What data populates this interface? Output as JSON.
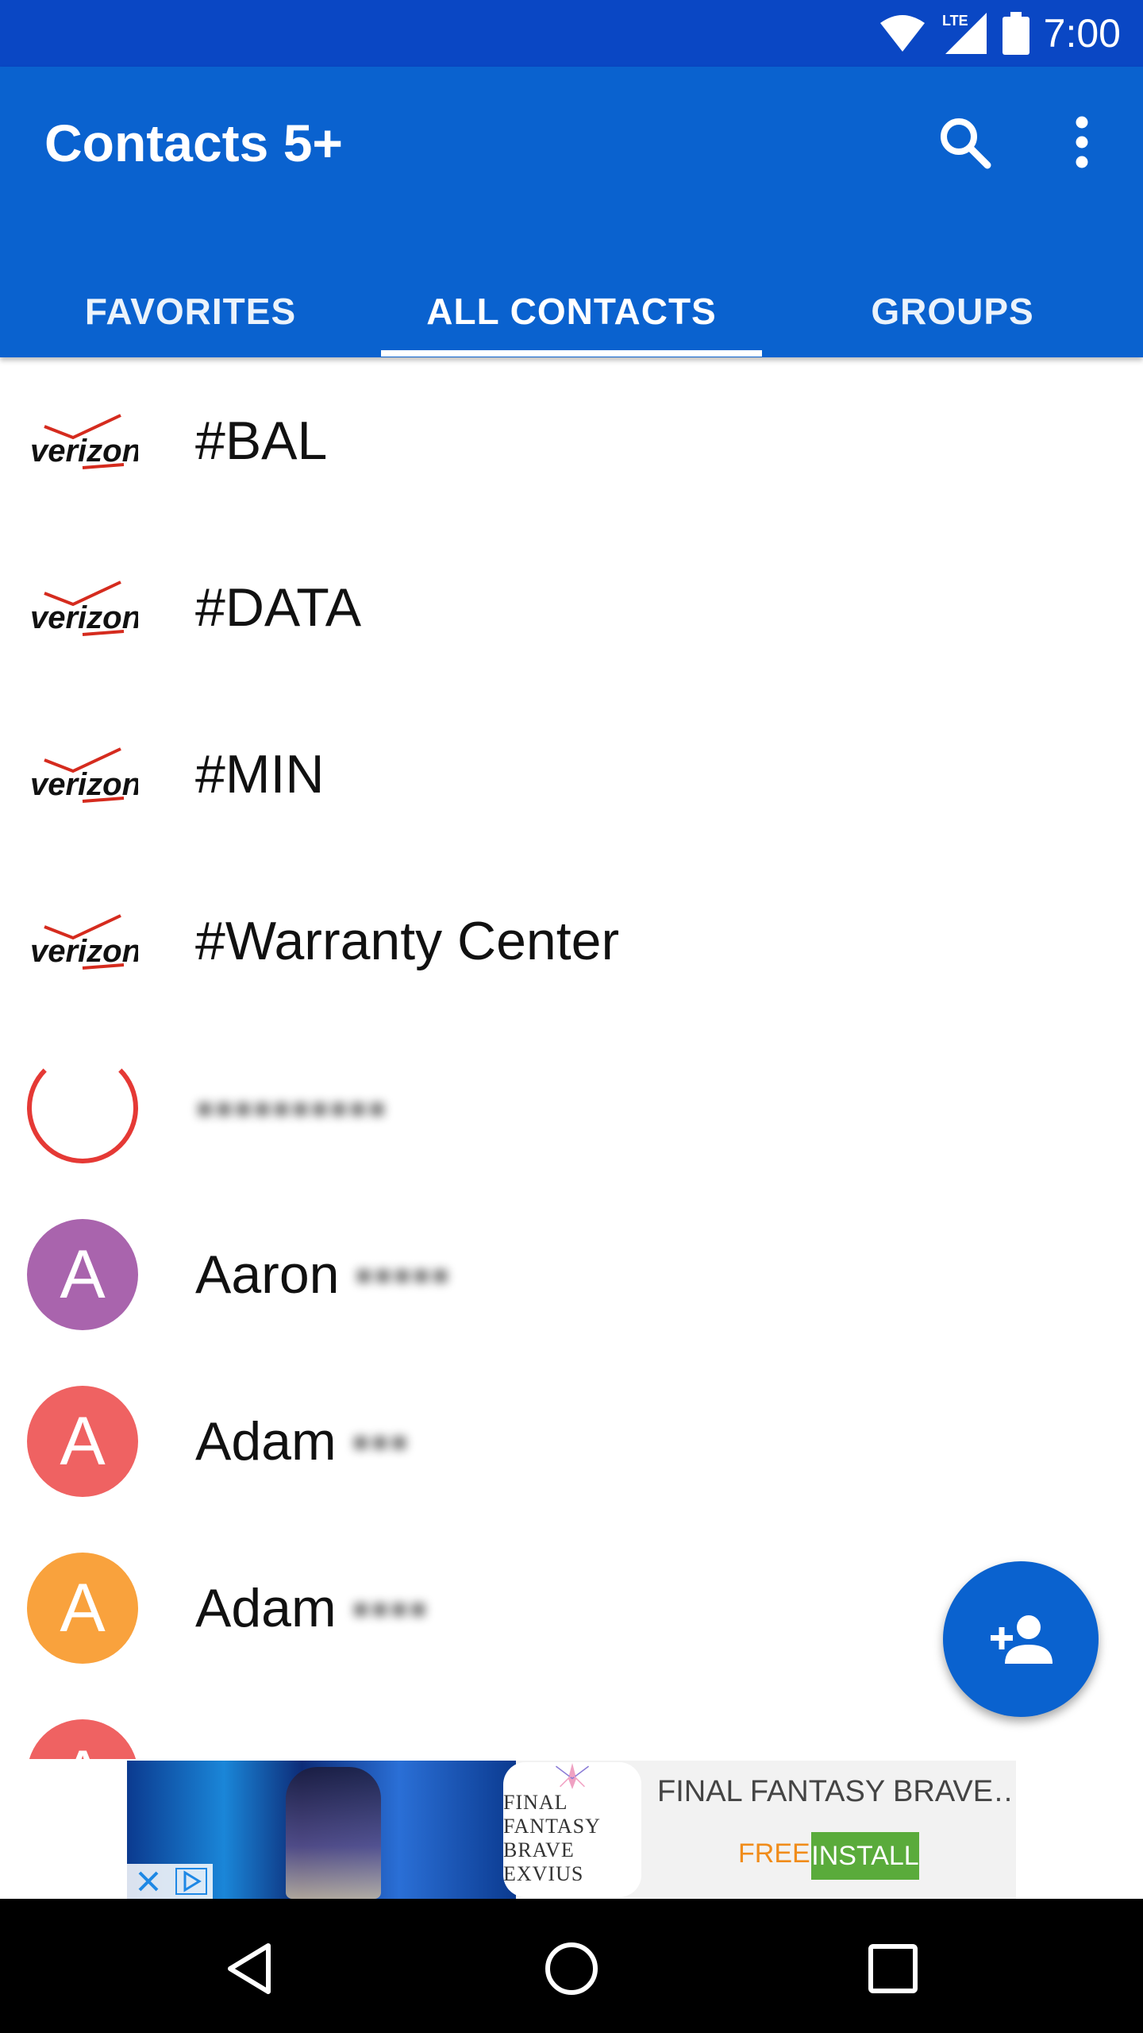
{
  "status_bar": {
    "time": "7:00",
    "network_label": "LTE",
    "icons": [
      "wifi-icon",
      "signal-icon",
      "battery-icon"
    ]
  },
  "app_bar": {
    "title": "Contacts 5+",
    "actions": [
      "search-icon",
      "more-vert-icon"
    ]
  },
  "tabs": [
    {
      "label": "FAVORITES",
      "selected": false
    },
    {
      "label": "ALL CONTACTS",
      "selected": true
    },
    {
      "label": "GROUPS",
      "selected": false
    }
  ],
  "contacts": [
    {
      "name": "#BAL",
      "avatar": "verizon-logo"
    },
    {
      "name": "#DATA",
      "avatar": "verizon-logo"
    },
    {
      "name": "#MIN",
      "avatar": "verizon-logo"
    },
    {
      "name": "#Warranty Center",
      "avatar": "verizon-logo"
    },
    {
      "name": "",
      "avatar": "red-ring-logo"
    },
    {
      "name": "Aaron",
      "avatar_letter": "A",
      "avatar_color": "#a964ad"
    },
    {
      "name": "Adam",
      "avatar_letter": "A",
      "avatar_color": "#ef6262"
    },
    {
      "name": "Adam",
      "avatar_letter": "A",
      "avatar_color": "#f9a23d"
    },
    {
      "name": "",
      "avatar_letter": "A",
      "avatar_color": "#ef6262"
    }
  ],
  "fab": {
    "icon": "add-person-icon"
  },
  "ad": {
    "title": "FINAL FANTASY BRAVE…",
    "logo_line1": "FINAL FANTASY",
    "logo_line2": "BRAVE EXVIUS",
    "price": "FREE",
    "install_label": "INSTALL"
  },
  "nav_bar": {
    "icons": [
      "back-icon",
      "home-icon",
      "recents-icon"
    ]
  },
  "colors": {
    "status_bar": "#0a47c4",
    "primary": "#0a62cf",
    "install_green": "#5aab3b",
    "free_orange": "#f08c1a"
  }
}
